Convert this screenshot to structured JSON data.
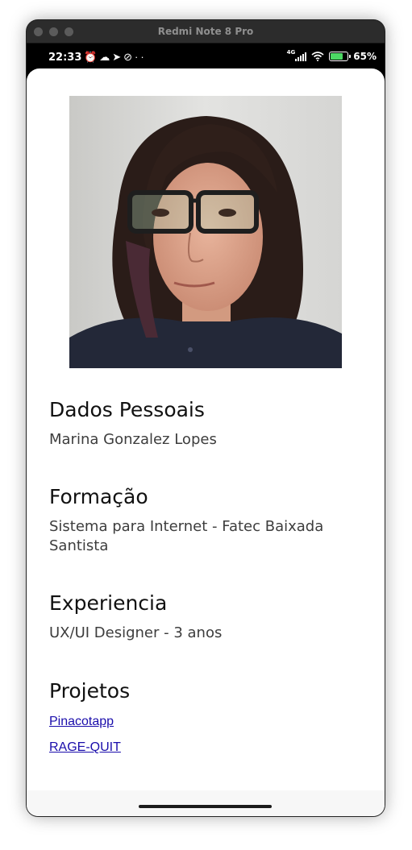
{
  "window": {
    "title": "Redmi Note 8 Pro"
  },
  "statusbar": {
    "time": "22:33",
    "left_icons": [
      "alarm-icon",
      "cloud-icon",
      "telegram-icon",
      "no-disturb-icon",
      "more-dots-icon"
    ],
    "network": "4G",
    "battery_percent": "65%",
    "battery_level": 0.65
  },
  "profile": {
    "photo_icon": "profile-photo"
  },
  "sections": {
    "personal": {
      "heading": "Dados Pessoais",
      "text": "Marina Gonzalez Lopes"
    },
    "education": {
      "heading": "Formação",
      "text": "Sistema para Internet - Fatec Baixada Santista"
    },
    "experience": {
      "heading": "Experiencia",
      "text": "UX/UI Designer - 3 anos"
    },
    "projects": {
      "heading": "Projetos",
      "links": [
        "Pinacotapp",
        "RAGE-QUIT"
      ]
    }
  }
}
